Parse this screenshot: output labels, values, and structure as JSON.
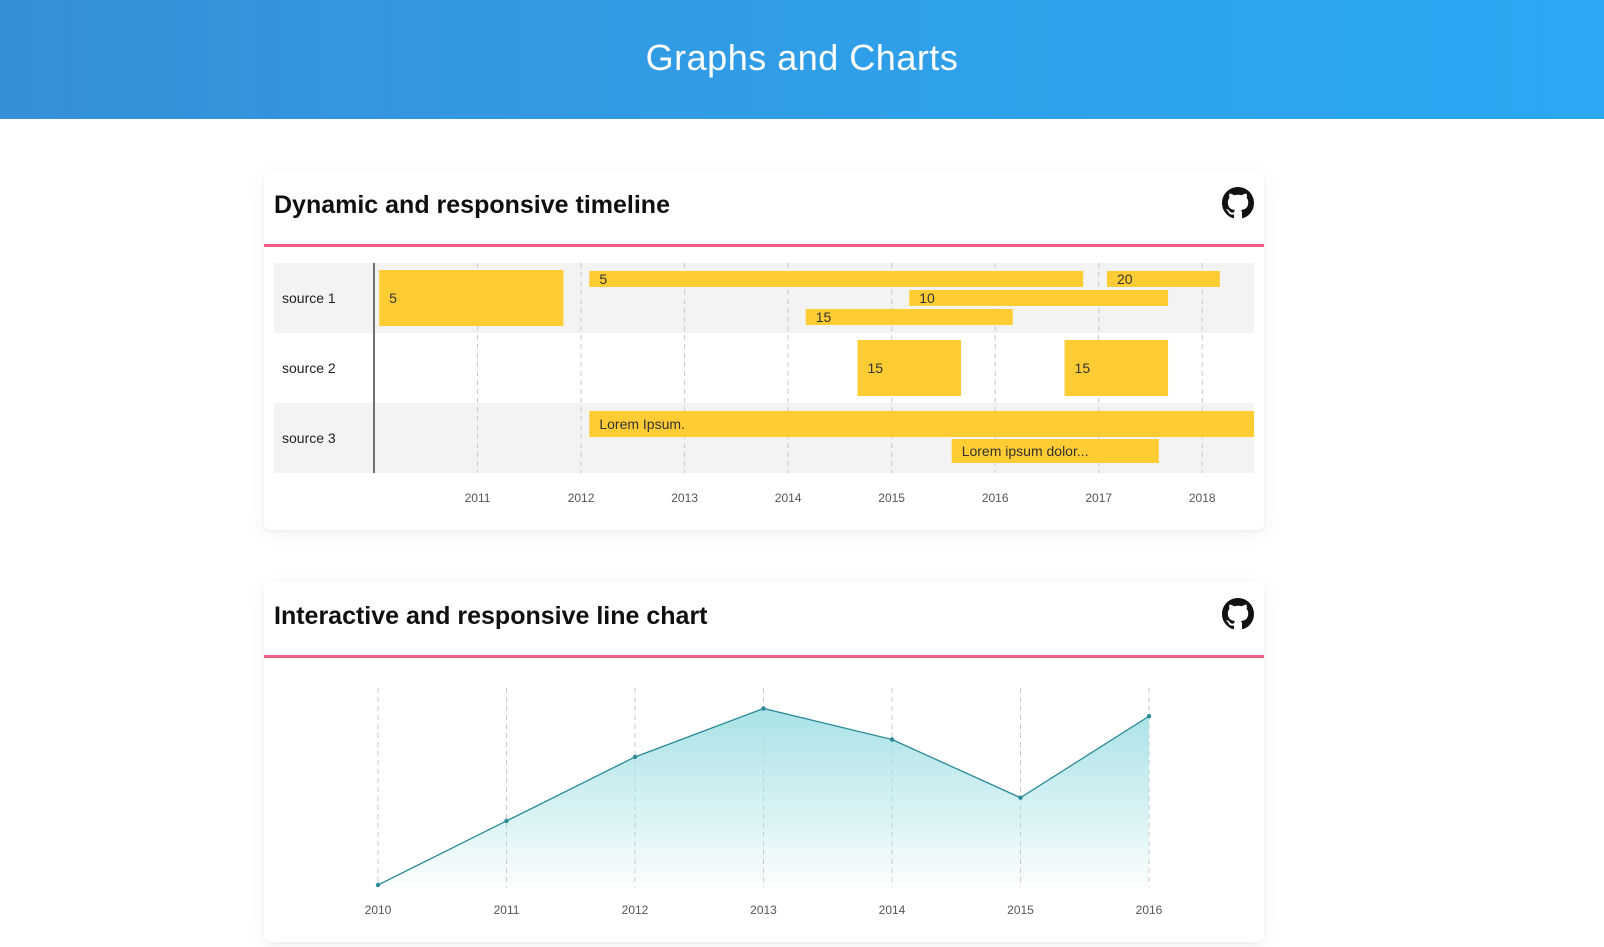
{
  "header": {
    "title": "Graphs and Charts"
  },
  "cards": [
    {
      "title": "Dynamic and responsive timeline",
      "icon": "github-icon"
    },
    {
      "title": "Interactive and responsive line chart",
      "icon": "github-icon"
    }
  ],
  "colors": {
    "accent_line": "#ee5d7f",
    "bar": "#ffcc33",
    "area_line": "#2a8a97",
    "area_fill": "#a8e2e6",
    "row_band": "#f3f3f3"
  },
  "chart_data": [
    {
      "type": "bar",
      "subtype": "timeline",
      "rows": [
        "source 1",
        "source 2",
        "source 3"
      ],
      "x_ticks": [
        "2011",
        "2012",
        "2013",
        "2014",
        "2015",
        "2016",
        "2017",
        "2018"
      ],
      "xlim": [
        2010.0,
        2018.5
      ],
      "items": [
        {
          "row": 0,
          "lane": "full",
          "start": 2010.05,
          "end": 2011.83,
          "label": "5"
        },
        {
          "row": 0,
          "lane": 0,
          "start": 2012.08,
          "end": 2016.85,
          "label": "5"
        },
        {
          "row": 0,
          "lane": 0,
          "start": 2017.08,
          "end": 2018.17,
          "label": "20"
        },
        {
          "row": 0,
          "lane": 1,
          "start": 2015.17,
          "end": 2017.67,
          "label": "10"
        },
        {
          "row": 0,
          "lane": 2,
          "start": 2014.17,
          "end": 2016.17,
          "label": "15"
        },
        {
          "row": 1,
          "lane": "full",
          "start": 2014.67,
          "end": 2015.67,
          "label": "15"
        },
        {
          "row": 1,
          "lane": "full",
          "start": 2016.67,
          "end": 2017.67,
          "label": "15"
        },
        {
          "row": 2,
          "lane": 0,
          "start": 2012.08,
          "end": 2018.5,
          "label": "Lorem Ipsum."
        },
        {
          "row": 2,
          "lane": 1,
          "start": 2015.58,
          "end": 2017.58,
          "label": "Lorem ipsum dolor..."
        }
      ]
    },
    {
      "type": "area",
      "x": [
        "2010",
        "2011",
        "2012",
        "2013",
        "2014",
        "2015",
        "2016"
      ],
      "values": [
        0,
        33,
        66,
        91,
        75,
        45,
        87
      ],
      "ylim": [
        0,
        100
      ]
    }
  ]
}
